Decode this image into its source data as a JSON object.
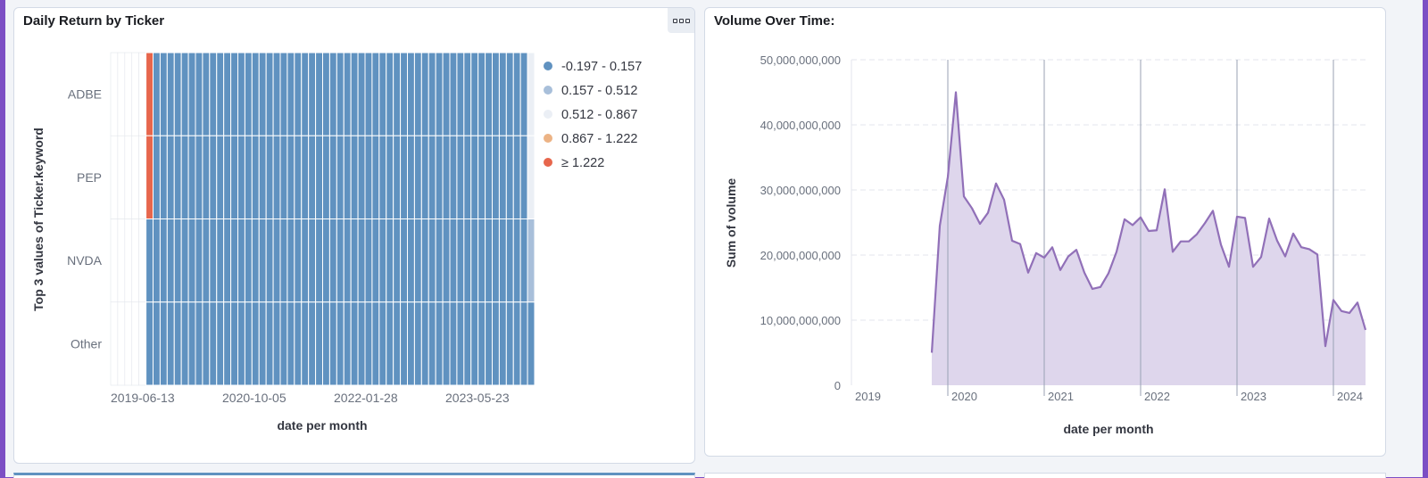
{
  "panels": {
    "left": {
      "title": "Daily Return by Ticker"
    },
    "right": {
      "title": "Volume Over Time:"
    }
  },
  "chart_data": [
    {
      "type": "heatmap",
      "title": "Daily Return by Ticker",
      "xlabel": "date per month",
      "ylabel": "Top 3 values of Ticker.keyword",
      "x_tick_labels": [
        "2019-06-13",
        "2020-10-05",
        "2022-01-28",
        "2023-05-23"
      ],
      "y_categories": [
        "ADBE",
        "PEP",
        "NVDA",
        "Other"
      ],
      "legend": {
        "position": "right",
        "items": [
          {
            "label": "-0.197 - 0.157",
            "color": "#6092c0"
          },
          {
            "label": "0.157 - 0.512",
            "color": "#a8bfda"
          },
          {
            "label": "0.512 - 0.867",
            "color": "#ebeff5"
          },
          {
            "label": "0.867 - 1.222",
            "color": "#ecb385"
          },
          {
            "label": "≥ 1.222",
            "color": "#e7664c"
          }
        ]
      },
      "x_range": [
        "2019-06",
        "2024-05"
      ],
      "cells": [
        {
          "ticker": "ADBE",
          "bucket": 4,
          "months": [
            "2019-11"
          ]
        },
        {
          "ticker": "ADBE",
          "bucket": 0,
          "months_range": [
            "2019-12",
            "2024-04"
          ]
        },
        {
          "ticker": "ADBE",
          "bucket": 2,
          "months": [
            "2024-05"
          ]
        },
        {
          "ticker": "PEP",
          "bucket": 4,
          "months": [
            "2019-11"
          ]
        },
        {
          "ticker": "PEP",
          "bucket": 0,
          "months_range": [
            "2019-12",
            "2024-04"
          ]
        },
        {
          "ticker": "PEP",
          "bucket": 2,
          "months": [
            "2024-05"
          ]
        },
        {
          "ticker": "NVDA",
          "bucket": 0,
          "months_range": [
            "2019-11",
            "2024-04"
          ]
        },
        {
          "ticker": "NVDA",
          "bucket": 1,
          "months": [
            "2024-05"
          ]
        },
        {
          "ticker": "Other",
          "bucket": 0,
          "months_range": [
            "2019-11",
            "2024-05"
          ]
        }
      ],
      "grid": true
    },
    {
      "type": "area",
      "title": "Volume Over Time:",
      "xlabel": "date per month",
      "ylabel": "Sum of volume",
      "x_tick_labels": [
        "2019",
        "2020",
        "2021",
        "2022",
        "2023",
        "2024"
      ],
      "y_tick_labels": [
        "0",
        "10,000,000,000",
        "20,000,000,000",
        "30,000,000,000",
        "40,000,000,000",
        "50,000,000,000"
      ],
      "ylim": [
        0,
        50000000000
      ],
      "x": [
        "2019-11",
        "2019-12",
        "2020-01",
        "2020-02",
        "2020-03",
        "2020-04",
        "2020-05",
        "2020-06",
        "2020-07",
        "2020-08",
        "2020-09",
        "2020-10",
        "2020-11",
        "2020-12",
        "2021-01",
        "2021-02",
        "2021-03",
        "2021-04",
        "2021-05",
        "2021-06",
        "2021-07",
        "2021-08",
        "2021-09",
        "2021-10",
        "2021-11",
        "2021-12",
        "2022-01",
        "2022-02",
        "2022-03",
        "2022-04",
        "2022-05",
        "2022-06",
        "2022-07",
        "2022-08",
        "2022-09",
        "2022-10",
        "2022-11",
        "2022-12",
        "2023-01",
        "2023-02",
        "2023-03",
        "2023-04",
        "2023-05",
        "2023-06",
        "2023-07",
        "2023-08",
        "2023-09",
        "2023-10",
        "2023-11",
        "2023-12",
        "2024-01",
        "2024-02",
        "2024-03",
        "2024-04"
      ],
      "series": [
        {
          "color": "#9170b8",
          "values": [
            5000000000,
            24500000000,
            32000000000,
            45000000000,
            29000000000,
            27200000000,
            24800000000,
            26500000000,
            31000000000,
            28500000000,
            22200000000,
            21700000000,
            17300000000,
            20300000000,
            19600000000,
            21200000000,
            17700000000,
            19800000000,
            20800000000,
            17300000000,
            14800000000,
            15100000000,
            17200000000,
            20500000000,
            25500000000,
            24600000000,
            25800000000,
            23700000000,
            23800000000,
            30100000000,
            20500000000,
            22100000000,
            22100000000,
            23200000000,
            24900000000,
            26800000000,
            21600000000,
            18200000000,
            25900000000,
            25700000000,
            18200000000,
            19700000000,
            25600000000,
            22200000000,
            19800000000,
            23300000000,
            21200000000,
            20900000000,
            20100000000,
            6000000000,
            13100000000,
            11400000000,
            11100000000,
            12700000000,
            8500000000
          ]
        }
      ],
      "legend": "none",
      "grid": true
    }
  ]
}
